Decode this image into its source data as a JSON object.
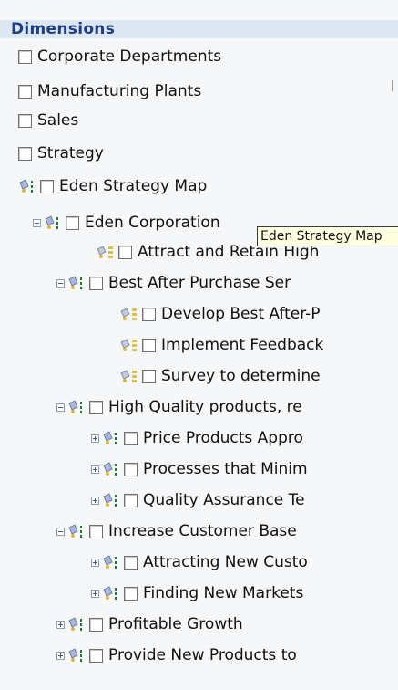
{
  "header": {
    "title": "Dimensions"
  },
  "tooltip": {
    "text": "Eden Strategy Map"
  },
  "tree": {
    "items": [
      {
        "label": "Corporate Departments"
      },
      {
        "label": "Manufacturing Plants"
      },
      {
        "label": "Sales"
      },
      {
        "label": "Strategy"
      },
      {
        "label": "Eden Strategy Map"
      },
      {
        "label": "Eden Corporation"
      },
      {
        "label": "Attract and Retain High"
      },
      {
        "label": "Best After Purchase Ser"
      },
      {
        "label": "Develop Best After-P"
      },
      {
        "label": "Implement Feedback"
      },
      {
        "label": "Survey to determine"
      },
      {
        "label": "High Quality products, re"
      },
      {
        "label": "Price Products Appro"
      },
      {
        "label": "Processes that Minim"
      },
      {
        "label": "Quality Assurance Te"
      },
      {
        "label": "Increase Customer Base"
      },
      {
        "label": "Attracting New Custo"
      },
      {
        "label": "Finding New Markets"
      },
      {
        "label": "Profitable Growth"
      },
      {
        "label": "Provide New Products to"
      }
    ]
  }
}
